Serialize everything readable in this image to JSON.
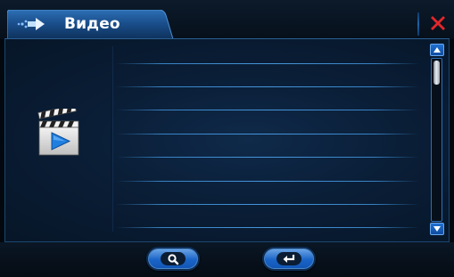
{
  "header": {
    "title": "Видео",
    "tab_icon": "arrow-right-icon",
    "close_icon": "close-icon"
  },
  "main": {
    "category_icon": "video-clapperboard-icon",
    "rows": [
      "",
      "",
      "",
      "",
      "",
      "",
      "",
      ""
    ]
  },
  "scrollbar": {
    "up_icon": "scroll-up-icon",
    "down_icon": "scroll-down-icon",
    "position": 0
  },
  "footer": {
    "search_icon": "search-icon",
    "back_icon": "return-icon"
  },
  "colors": {
    "accent": "#1a64c8",
    "close": "#e0272b",
    "row_line": "#468edc"
  }
}
